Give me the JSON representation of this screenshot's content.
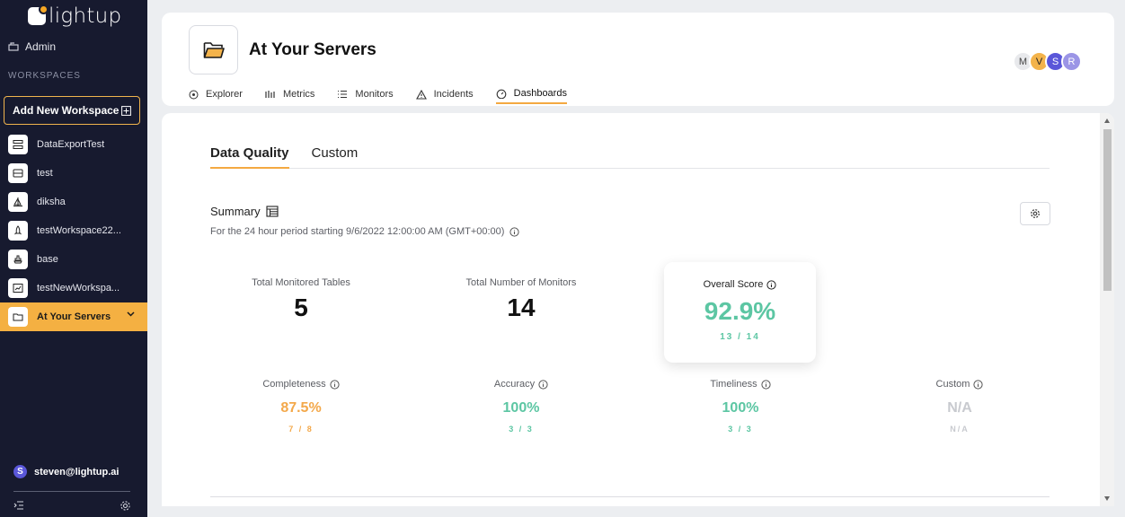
{
  "sidebar": {
    "logo_text": "lightup",
    "admin_label": "Admin",
    "workspaces_heading": "WORKSPACES",
    "add_workspace_label": "Add New Workspace",
    "items": [
      {
        "label": "DataExportTest",
        "icon": "server-stack-icon"
      },
      {
        "label": "test",
        "icon": "server-icon"
      },
      {
        "label": "diksha",
        "icon": "sailboat-icon"
      },
      {
        "label": "testWorkspace22...",
        "icon": "rocket-icon"
      },
      {
        "label": "base",
        "icon": "ship-icon"
      },
      {
        "label": "testNewWorkspa...",
        "icon": "chart-window-icon"
      },
      {
        "label": "At Your Servers",
        "icon": "folder-icon",
        "active": true
      }
    ],
    "user_initial": "S",
    "user_email": "steven@lightup.ai"
  },
  "header": {
    "title": "At Your Servers",
    "avatars": [
      "M",
      "V",
      "S",
      "R"
    ],
    "tabs": [
      {
        "label": "Explorer",
        "icon": "explorer-icon"
      },
      {
        "label": "Metrics",
        "icon": "metrics-icon"
      },
      {
        "label": "Monitors",
        "icon": "list-icon"
      },
      {
        "label": "Incidents",
        "icon": "warning-icon"
      },
      {
        "label": "Dashboards",
        "icon": "gauge-icon",
        "active": true
      }
    ]
  },
  "main": {
    "subtabs": [
      {
        "label": "Data Quality",
        "active": true
      },
      {
        "label": "Custom"
      }
    ],
    "summary_title": "Summary",
    "summary_subtitle": "For the 24 hour period starting 9/6/2022 12:00:00 AM (GMT+00:00)",
    "stats": {
      "tables_label": "Total Monitored Tables",
      "tables_value": "5",
      "monitors_label": "Total Number of Monitors",
      "monitors_value": "14",
      "overall_label": "Overall Score",
      "overall_value": "92.9%",
      "overall_fraction": "13 / 14"
    },
    "dimensions": [
      {
        "label": "Completeness",
        "value": "87.5%",
        "fraction": "7 / 8",
        "status": "orange"
      },
      {
        "label": "Accuracy",
        "value": "100%",
        "fraction": "3 / 3",
        "status": "green"
      },
      {
        "label": "Timeliness",
        "value": "100%",
        "fraction": "3 / 3",
        "status": "green"
      },
      {
        "label": "Custom",
        "value": "N/A",
        "fraction": "N/A",
        "status": "gray"
      }
    ]
  },
  "colors": {
    "sidebar_bg": "#171a2f",
    "accent": "#f4b042",
    "score_green": "#5cc6a3",
    "warn_orange": "#f3a84a",
    "na_gray": "#c8cacf"
  }
}
